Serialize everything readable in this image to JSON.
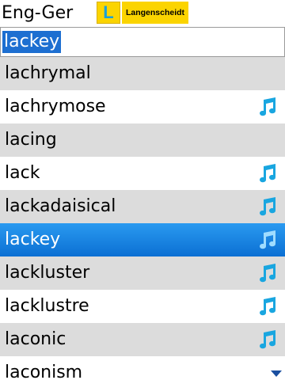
{
  "header": {
    "direction": "Eng-Ger",
    "logo_letter": "L",
    "logo_text": "Langenscheidt"
  },
  "search": {
    "value": "lackey"
  },
  "list": {
    "items": [
      {
        "word": "lachrymal",
        "audio": false,
        "selected": false
      },
      {
        "word": "lachrymose",
        "audio": true,
        "selected": false
      },
      {
        "word": "lacing",
        "audio": false,
        "selected": false
      },
      {
        "word": "lack",
        "audio": true,
        "selected": false
      },
      {
        "word": "lackadaisical",
        "audio": true,
        "selected": false
      },
      {
        "word": "lackey",
        "audio": true,
        "selected": true
      },
      {
        "word": "lackluster",
        "audio": true,
        "selected": false
      },
      {
        "word": "lacklustre",
        "audio": true,
        "selected": false
      },
      {
        "word": "laconic",
        "audio": true,
        "selected": false
      },
      {
        "word": "laconism",
        "audio": false,
        "selected": false
      }
    ]
  },
  "colors": {
    "selection": "#1d6fd1",
    "row_alt": "#dcdcdc",
    "note_icon": "#19a6e0",
    "logo_yellow": "#fbd400"
  },
  "icons": {
    "audio": "music-note-icon",
    "scroll_up": "scroll-up-arrow-icon",
    "scroll_down": "scroll-down-arrow-icon"
  }
}
